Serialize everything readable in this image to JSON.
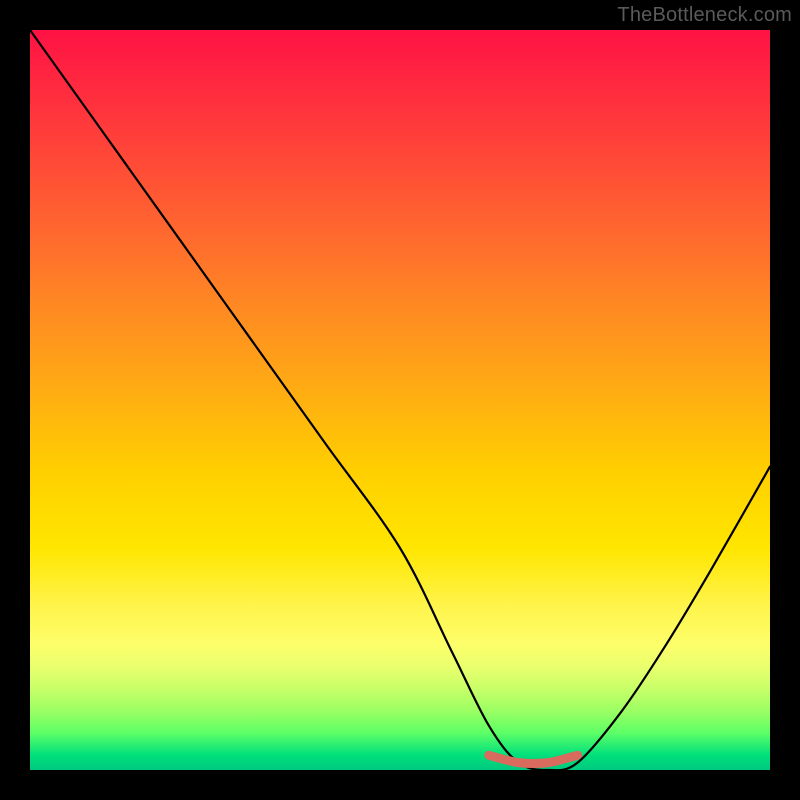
{
  "attribution": "TheBottleneck.com",
  "chart_data": {
    "type": "line",
    "title": "",
    "xlabel": "",
    "ylabel": "",
    "xlim": [
      0,
      100
    ],
    "ylim": [
      0,
      100
    ],
    "series": [
      {
        "name": "curve",
        "color": "#000000",
        "x": [
          0,
          10,
          20,
          30,
          40,
          50,
          57,
          62,
          66,
          70,
          74,
          80,
          86,
          92,
          100
        ],
        "y": [
          100,
          86,
          72,
          58,
          44,
          30,
          16,
          6,
          1,
          0,
          1,
          8,
          17,
          27,
          41
        ]
      },
      {
        "name": "highlight",
        "color": "#d96a5e",
        "x": [
          62,
          66,
          70,
          74
        ],
        "y": [
          2,
          1,
          1,
          2
        ]
      }
    ],
    "background_gradient": {
      "direction": "top-to-bottom",
      "stops": [
        {
          "pos": 0,
          "color": "#ff1244"
        },
        {
          "pos": 18,
          "color": "#ff4a37"
        },
        {
          "pos": 38,
          "color": "#ff8b22"
        },
        {
          "pos": 60,
          "color": "#ffd000"
        },
        {
          "pos": 78,
          "color": "#fff44d"
        },
        {
          "pos": 89,
          "color": "#c8ff68"
        },
        {
          "pos": 100,
          "color": "#00c97e"
        }
      ]
    }
  }
}
